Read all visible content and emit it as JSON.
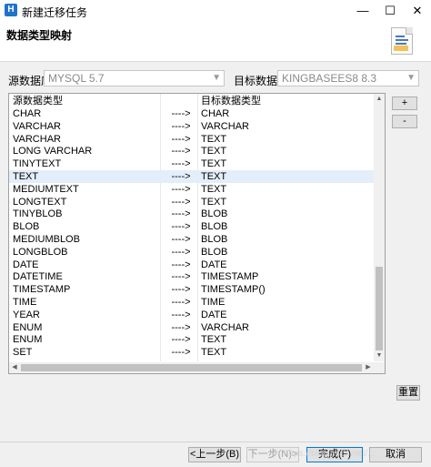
{
  "window": {
    "title": "新建迁移任务",
    "app_icon_letter": "H",
    "minimize_glyph": "—",
    "maximize_glyph": "☐",
    "close_glyph": "✕"
  },
  "header": {
    "page_title": "数据类型映射",
    "icon": "document-icon"
  },
  "source": {
    "label": "源数据库:",
    "value": "MYSQL 5.7"
  },
  "target": {
    "label": "目标数据库:",
    "value": "KINGBASEES8 8.3"
  },
  "table": {
    "headers": {
      "source_type": "源数据类型",
      "target_type": "目标数据类型"
    },
    "rows": [
      {
        "source": "CHAR",
        "arrow": "---->",
        "target": "CHAR"
      },
      {
        "source": "VARCHAR",
        "arrow": "---->",
        "target": "VARCHAR"
      },
      {
        "source": "VARCHAR",
        "arrow": "---->",
        "target": "TEXT"
      },
      {
        "source": "LONG VARCHAR",
        "arrow": "---->",
        "target": "TEXT"
      },
      {
        "source": "TINYTEXT",
        "arrow": "---->",
        "target": "TEXT"
      },
      {
        "source": "TEXT",
        "arrow": "---->",
        "target": "TEXT",
        "selected": true
      },
      {
        "source": "MEDIUMTEXT",
        "arrow": "---->",
        "target": "TEXT"
      },
      {
        "source": "LONGTEXT",
        "arrow": "---->",
        "target": "TEXT"
      },
      {
        "source": "TINYBLOB",
        "arrow": "---->",
        "target": "BLOB"
      },
      {
        "source": "BLOB",
        "arrow": "---->",
        "target": "BLOB"
      },
      {
        "source": "MEDIUMBLOB",
        "arrow": "---->",
        "target": "BLOB"
      },
      {
        "source": "LONGBLOB",
        "arrow": "---->",
        "target": "BLOB"
      },
      {
        "source": "DATE",
        "arrow": "---->",
        "target": "DATE"
      },
      {
        "source": "DATETIME",
        "arrow": "---->",
        "target": "TIMESTAMP"
      },
      {
        "source": "TIMESTAMP",
        "arrow": "---->",
        "target": "TIMESTAMP()"
      },
      {
        "source": "TIME",
        "arrow": "---->",
        "target": "TIME"
      },
      {
        "source": "YEAR",
        "arrow": "---->",
        "target": "DATE"
      },
      {
        "source": "ENUM",
        "arrow": "---->",
        "target": "VARCHAR"
      },
      {
        "source": "ENUM",
        "arrow": "---->",
        "target": "TEXT"
      },
      {
        "source": "SET",
        "arrow": "---->",
        "target": "TEXT"
      }
    ]
  },
  "side_buttons": {
    "add": "+",
    "remove": "-",
    "reset": "重置"
  },
  "footer": {
    "back": "<上一步(B)",
    "next": "下一步(N)>",
    "finish": "完成(F)",
    "cancel": "取消"
  },
  "watermark": "https://blog.csdn.net/..."
}
